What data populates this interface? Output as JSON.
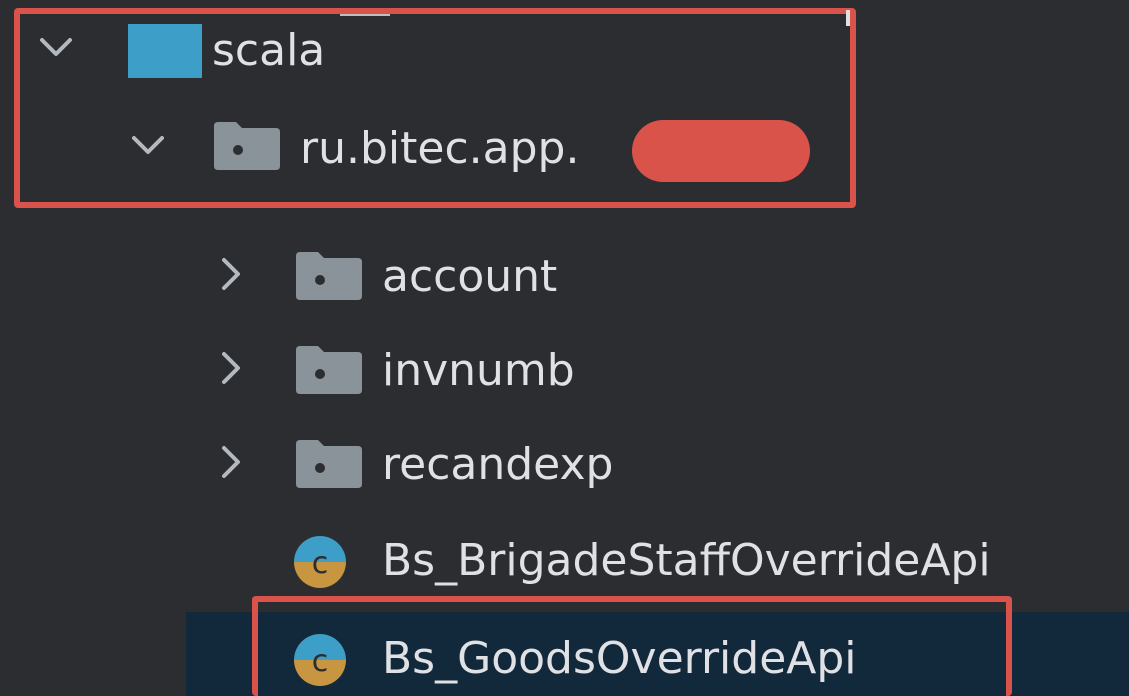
{
  "project_tree": {
    "root": {
      "label": "scala",
      "expanded": true,
      "icon": "source-folder-icon"
    },
    "package": {
      "label": "ru.bitec.app.",
      "expanded": true,
      "icon": "package-icon"
    },
    "children": [
      {
        "label": "account",
        "type": "package",
        "expanded": false
      },
      {
        "label": "invnumb",
        "type": "package",
        "expanded": false
      },
      {
        "label": "recandexp",
        "type": "package",
        "expanded": false
      },
      {
        "label": "Bs_BrigadeStaffOverrideApi",
        "type": "scala-class",
        "selected": false
      },
      {
        "label": "Bs_GoodsOverrideApi",
        "type": "scala-class",
        "selected": true
      }
    ]
  },
  "colors": {
    "background": "#2b2d30",
    "selection": "#12283b",
    "annotation_red": "#d9534a",
    "source_folder_blue": "#3d9ec8",
    "package_gray": "#8a9399"
  }
}
